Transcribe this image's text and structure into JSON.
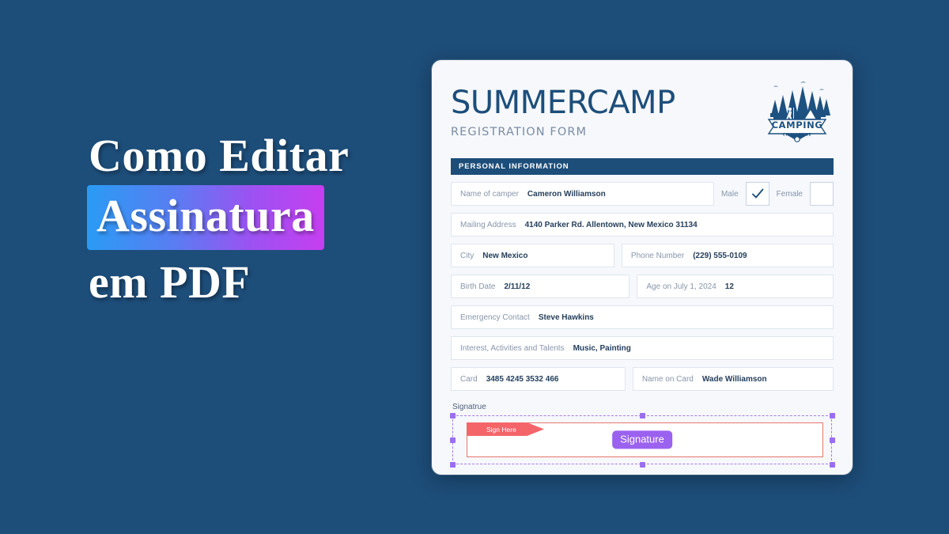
{
  "promo": {
    "line1": "Como Editar",
    "highlight": "Assinatura",
    "line3": "em PDF",
    "gradient_start": "#2a9bf5",
    "gradient_end": "#c63ef0",
    "background_color": "#1d4d79"
  },
  "document": {
    "brand_title": "SUMMERCAMP",
    "brand_subtitle": "REGISTRATION FORM",
    "logo": {
      "name": "camping-challenge-badge",
      "primary_text": "CAMPING",
      "secondary_text": "CHALLENGE"
    },
    "section_bar": {
      "label": "PERSONAL INFORMATION",
      "color": "#1d4e7a"
    },
    "fields": {
      "name_of_camper": {
        "label": "Name of camper",
        "value": "Cameron Williamson"
      },
      "male": {
        "label": "Male",
        "checked": true
      },
      "female": {
        "label": "Female",
        "checked": false
      },
      "mailing_address": {
        "label": "Mailing Address",
        "value": "4140 Parker Rd. Allentown, New Mexico 31134"
      },
      "city": {
        "label": "City",
        "value": "New Mexico"
      },
      "phone_number": {
        "label": "Phone Number",
        "value": "(229) 555-0109"
      },
      "birth_date": {
        "label": "Birth Date",
        "value": "2/11/12"
      },
      "age": {
        "label": "Age on July 1, 2024",
        "value": "12"
      },
      "emergency_contact": {
        "label": "Emergency Contact",
        "value": "Steve Hawkins"
      },
      "interests": {
        "label": "Interest, Activities and Talents",
        "value": "Music, Painting"
      },
      "card": {
        "label": "Card",
        "value": "3485 4245 3532 466"
      },
      "name_on_card": {
        "label": "Name on Card",
        "value": "Wade Williamson"
      }
    },
    "signature": {
      "label": "Signatrue",
      "sign_here_tag": "Sign Here",
      "button_label": "Signature",
      "button_color": "#9b61ef",
      "selection_color": "#9b6ef0",
      "tag_color": "#f4656a"
    }
  }
}
